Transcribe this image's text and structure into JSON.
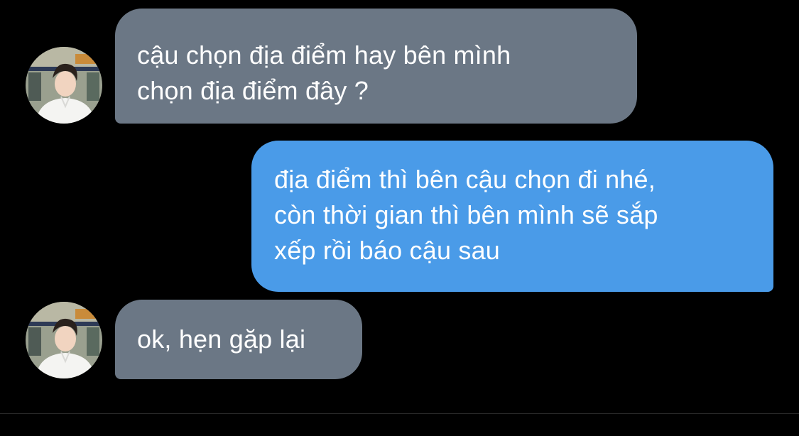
{
  "conversation": {
    "messages": [
      {
        "sender": "other",
        "lines": [
          "cậu chọn địa điểm hay bên mình",
          "chọn địa điểm đây ?"
        ]
      },
      {
        "sender": "me",
        "lines": [
          "địa điểm thì bên cậu chọn đi nhé,",
          "còn thời gian thì bên mình sẽ sắp",
          "xếp rồi báo cậu sau"
        ]
      },
      {
        "sender": "other",
        "lines": [
          "ok, hẹn gặp lại"
        ]
      }
    ]
  },
  "colors": {
    "background": "#000000",
    "incoming_bubble": "#6b7785",
    "outgoing_bubble": "#4a9be8",
    "text": "#ffffff"
  },
  "icons": {
    "contact_avatar": "contact-avatar-photo"
  }
}
